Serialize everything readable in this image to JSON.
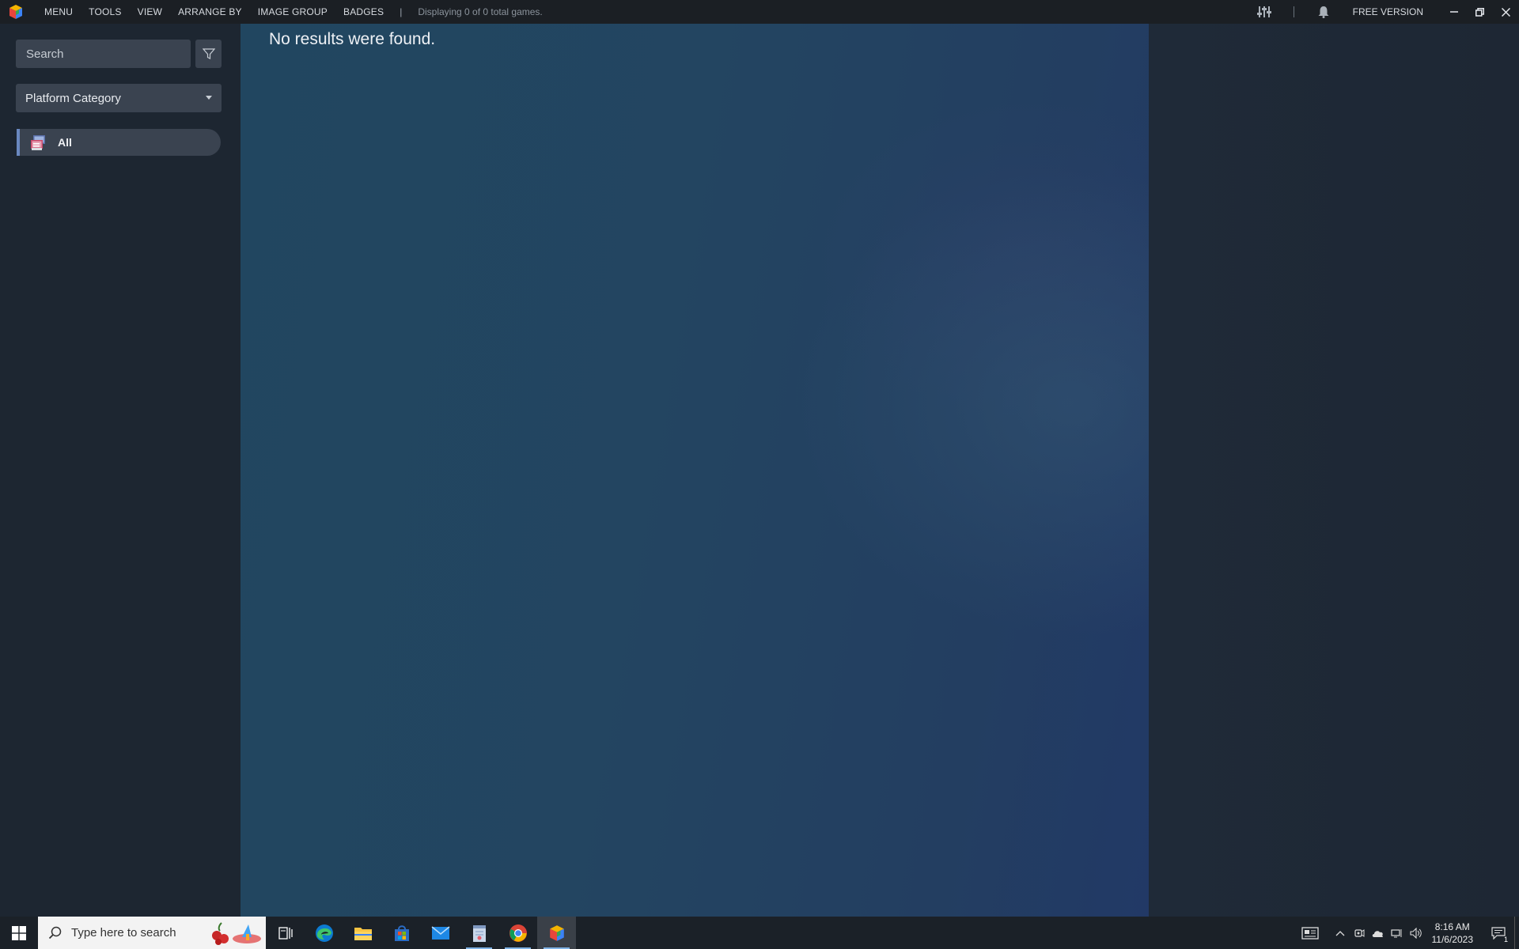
{
  "titlebar": {
    "menu": [
      "MENU",
      "TOOLS",
      "VIEW",
      "ARRANGE BY",
      "IMAGE GROUP",
      "BADGES"
    ],
    "separator": "|",
    "status": "Displaying 0 of 0 total games.",
    "free_version": "FREE VERSION"
  },
  "sidebar": {
    "search_placeholder": "Search",
    "platform_select": "Platform Category",
    "items": [
      {
        "label": "All"
      }
    ]
  },
  "main": {
    "message": "No results were found."
  },
  "taskbar": {
    "search_placeholder": "Type here to search",
    "apps": [
      "task-view",
      "edge",
      "file-explorer",
      "microsoft-store",
      "mail",
      "notepad",
      "chrome",
      "launchbox"
    ],
    "time": "8:16 AM",
    "date": "11/6/2023",
    "notification_count": "1"
  },
  "colors": {
    "accent": "#6a88c0",
    "titlebar_bg": "#1b1f24",
    "sidebar_bg": "#1d2631",
    "control_bg": "#3a4350"
  }
}
